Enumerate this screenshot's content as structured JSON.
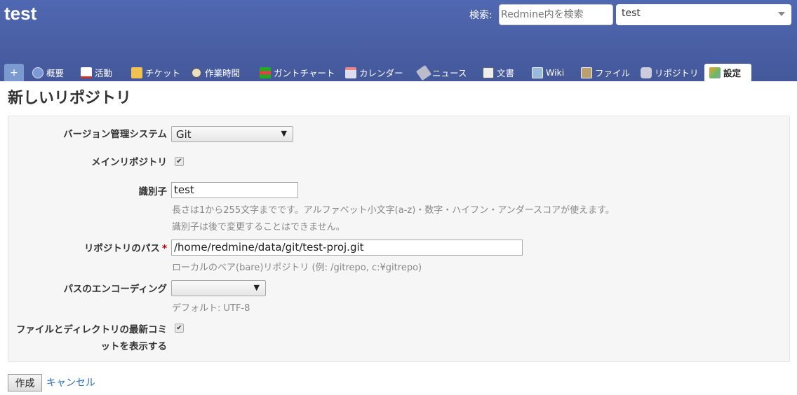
{
  "header": {
    "title": "test",
    "search_label": "検索:",
    "search_placeholder": "Redmine内を検索",
    "project_select": "test"
  },
  "tabs": {
    "new": "+",
    "overview": "概要",
    "activity": "活動",
    "issues": "チケット",
    "time": "作業時間",
    "gantt": "ガントチャート",
    "calendar": "カレンダー",
    "news": "ニュース",
    "documents": "文書",
    "wiki": "Wiki",
    "files": "ファイル",
    "repository": "リポジトリ",
    "settings": "設定"
  },
  "page_title": "新しいリポジトリ",
  "form": {
    "scm_label": "バージョン管理システム",
    "scm_value": "Git",
    "main_label": "メインリポジトリ",
    "main_checked": true,
    "identifier_label": "識別子",
    "identifier_value": "test",
    "identifier_info1": "長さは1から255文字までです。アルファベット小文字(a-z)・数字・ハイフン・アンダースコアが使えます。",
    "identifier_info2": "識別子は後で変更することはできません。",
    "path_label": "リポジトリのパス",
    "required": "*",
    "path_value": "/home/redmine/data/git/test-proj.git",
    "path_info": "ローカルのベア(bare)リポジトリ (例: /gitrepo, c:¥gitrepo)",
    "encoding_label": "パスのエンコーディング",
    "encoding_value": "",
    "encoding_info": "デフォルト: UTF-8",
    "report_label1": "ファイルとディレクトリの最新コミ",
    "report_label2": "ットを表示する",
    "report_checked": true,
    "check_mark": "✔"
  },
  "actions": {
    "create": "作成",
    "cancel": "キャンセル"
  }
}
